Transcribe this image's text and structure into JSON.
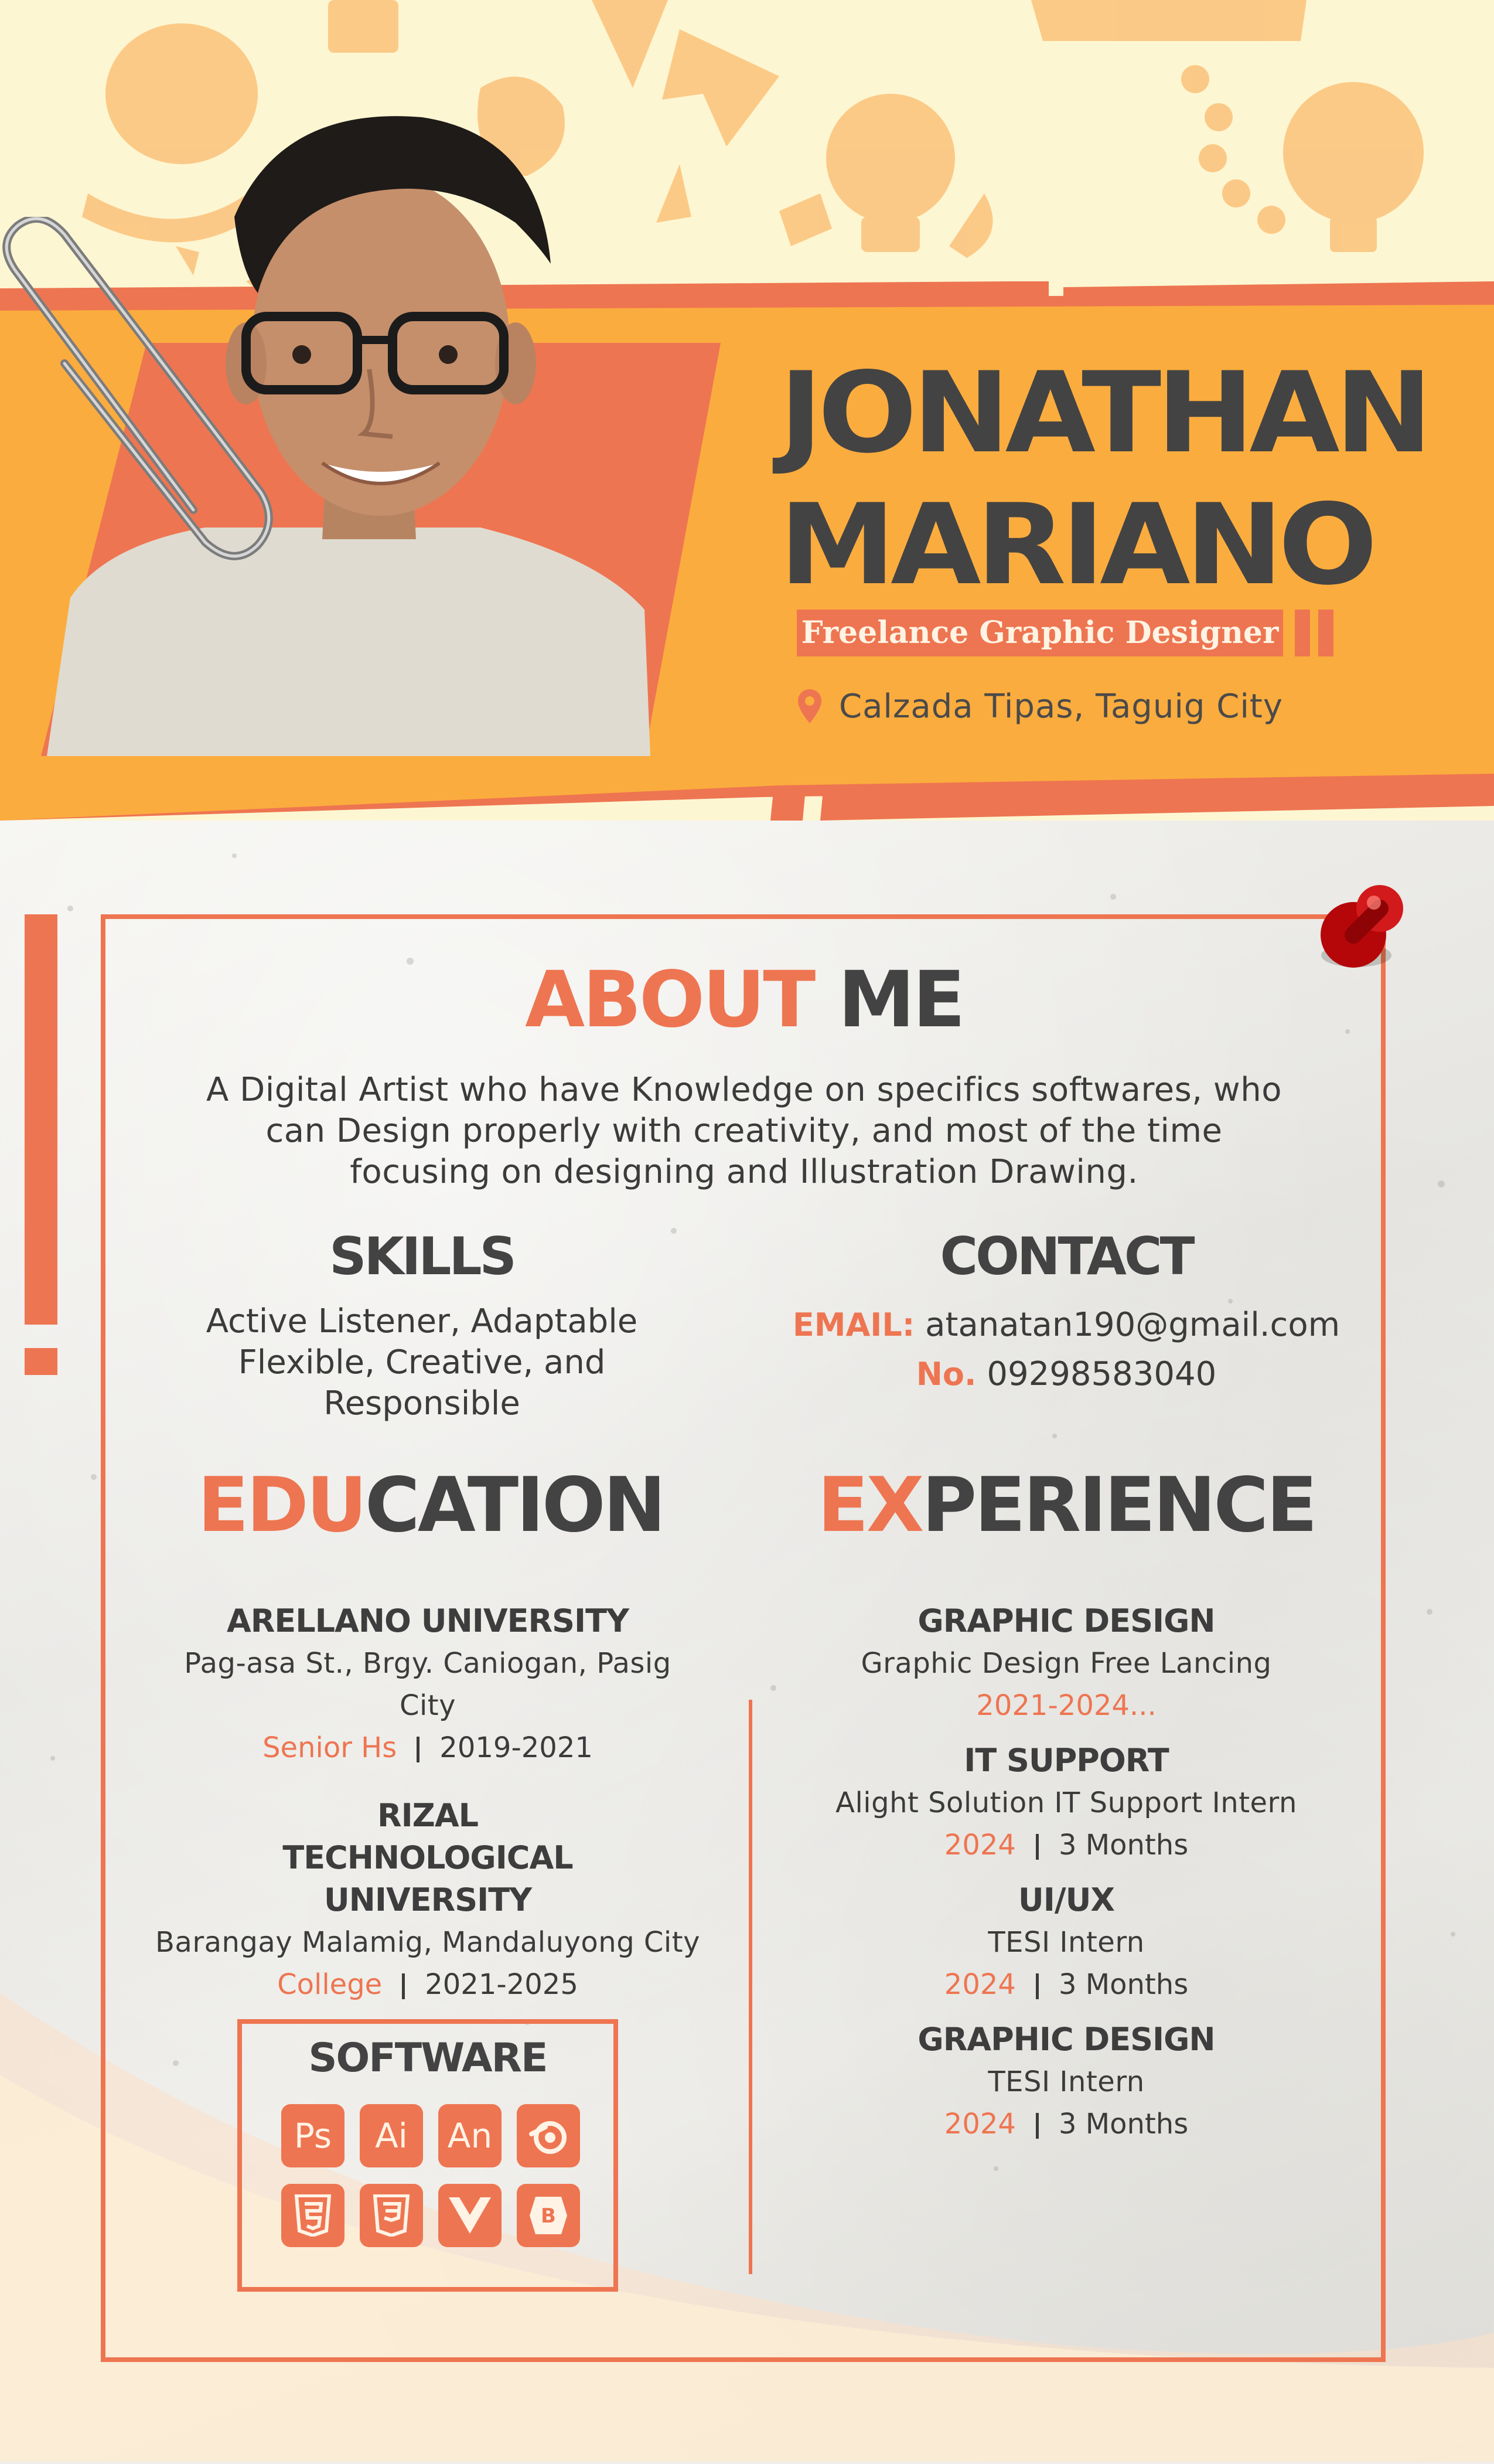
{
  "header": {
    "first_name": "JONATHAN",
    "last_name": "MARIANO",
    "role": "Freelance Graphic Designer",
    "location": "Calzada Tipas, Taguig City",
    "location_icon": "map-pin-icon"
  },
  "about": {
    "title_accent": "ABOUT",
    "title_rest": " ME",
    "body": "A Digital Artist who have Knowledge on specifics softwares, who can Design properly with creativity, and most of the time focusing on designing and Illustration Drawing."
  },
  "skills": {
    "title": "SKILLS",
    "body": "Active Listener, Adaptable Flexible, Creative, and Responsible"
  },
  "contact": {
    "title": "CONTACT",
    "email_label": "EMAIL:",
    "email": "atanatan190@gmail.com",
    "phone_label": "No.",
    "phone": "09298583040"
  },
  "education": {
    "title_accent": "EDU",
    "title_rest": "CATION",
    "entries": [
      {
        "name": "ARELLANO UNIVERSITY",
        "address": "Pag-asa St., Brgy. Caniogan, Pasig City",
        "level": "Senior Hs",
        "years": "2019-2021"
      },
      {
        "name": "RIZAL TECHNOLOGICAL UNIVERSITY",
        "address": "Barangay Malamig, Mandaluyong City",
        "level": "College",
        "years": "2021-2025"
      }
    ]
  },
  "experience": {
    "title_accent": "EX",
    "title_rest": "PERIENCE",
    "entries": [
      {
        "title": "GRAPHIC DESIGN",
        "detail": "Graphic Design Free Lancing",
        "year": "2021-2024...",
        "duration": ""
      },
      {
        "title": "IT SUPPORT",
        "detail": "Alight Solution IT Support Intern",
        "year": "2024",
        "duration": "3 Months"
      },
      {
        "title": "UI/UX",
        "detail": "TESI Intern",
        "year": "2024",
        "duration": "3 Months"
      },
      {
        "title": "GRAPHIC DESIGN",
        "detail": "TESI Intern",
        "year": "2024",
        "duration": "3 Months"
      }
    ]
  },
  "software": {
    "title": "SOFTWARE",
    "icons": [
      {
        "label": "Ps",
        "icon": "photoshop-icon"
      },
      {
        "label": "Ai",
        "icon": "illustrator-icon"
      },
      {
        "label": "An",
        "icon": "animate-icon"
      },
      {
        "label": "",
        "icon": "blender-icon"
      },
      {
        "label": "",
        "icon": "html5-icon"
      },
      {
        "label": "",
        "icon": "css3-icon"
      },
      {
        "label": "",
        "icon": "vue-icon"
      },
      {
        "label": "",
        "icon": "bootstrap-icon"
      }
    ]
  },
  "colors": {
    "accent": "#ee7551",
    "band": "#fbac3e",
    "text_dark": "#434343",
    "doodle_bg": "#fdf6d2"
  }
}
